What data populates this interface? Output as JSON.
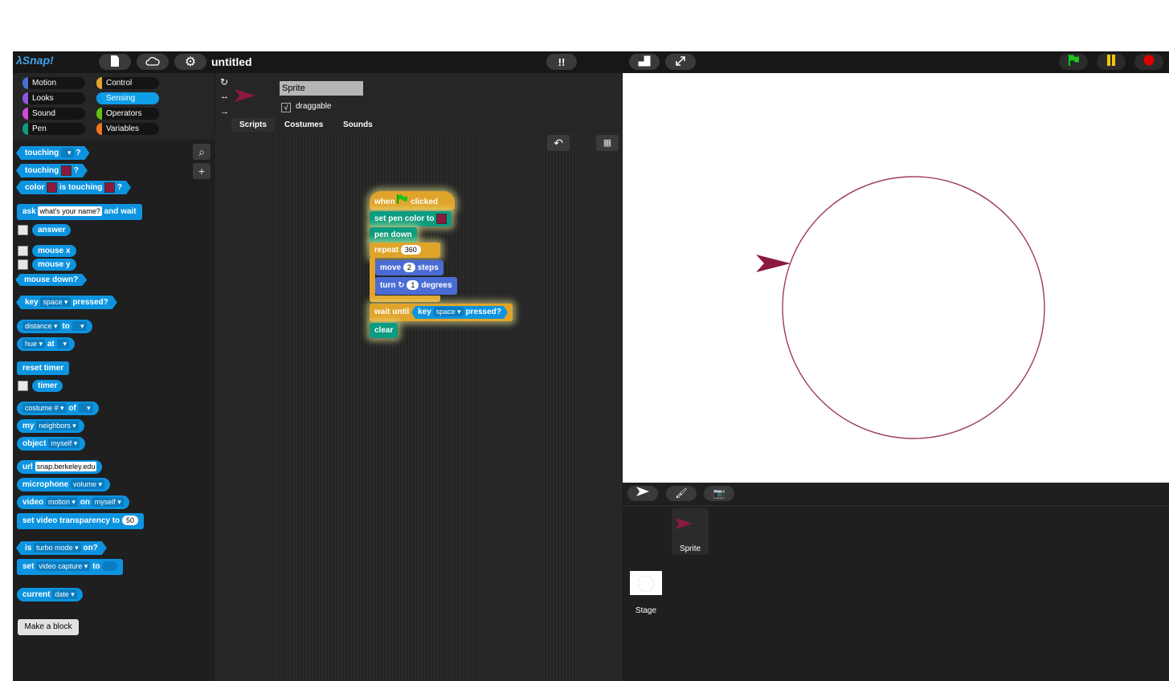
{
  "app": {
    "title": "untitled",
    "logo": "λSnap!"
  },
  "categories": [
    "Motion",
    "Control",
    "Looks",
    "Sensing",
    "Sound",
    "Operators",
    "Pen",
    "Variables"
  ],
  "palette": {
    "touching": "touching",
    "q": "?",
    "color": "color",
    "is_touching": "is touching",
    "ask": "ask",
    "ask_default": "what's your name?",
    "and_wait": "and wait",
    "answer": "answer",
    "mouse_x": "mouse x",
    "mouse_y": "mouse y",
    "mouse_down": "mouse down?",
    "key": "key",
    "space": "space",
    "pressed": "pressed?",
    "distance": "distance",
    "to": "to",
    "hue": "hue",
    "at": "at",
    "reset_timer": "reset timer",
    "timer": "timer",
    "costume": "costume #",
    "of": "of",
    "my": "my",
    "neighbors": "neighbors",
    "object": "object",
    "myself": "myself",
    "url": "url",
    "url_default": "snap.berkeley.edu",
    "microphone": "microphone",
    "volume": "volume",
    "video": "video",
    "motion": "motion",
    "on": "on",
    "set_video_transparency": "set video transparency to",
    "transparency_value": "50",
    "is": "is",
    "turbo_mode": "turbo mode",
    "on_q": "on?",
    "set": "set",
    "video_capture": "video capture",
    "current": "current",
    "date": "date",
    "make_block": "Make a block"
  },
  "sprite": {
    "name": "Sprite",
    "draggable_label": "draggable",
    "draggable_check": "√",
    "tabs": [
      "Scripts",
      "Costumes",
      "Sounds"
    ]
  },
  "script": {
    "when": "when",
    "clicked": "clicked",
    "set_pen_color": "set pen color to",
    "pen_down": "pen down",
    "repeat": "repeat",
    "repeat_count": "360",
    "move": "move",
    "move_steps": "2",
    "steps": "steps",
    "turn": "turn",
    "turn_deg": "1",
    "degrees": "degrees",
    "wait_until": "wait until",
    "key": "key",
    "space": "space",
    "pressed": "pressed?",
    "clear": "clear"
  },
  "corral": {
    "sprite_label": "Sprite",
    "stage_label": "Stage"
  },
  "colors": {
    "pen": "#8b1a3c",
    "sensing": "#0d94e0",
    "control": "#e1a42a",
    "penBlock": "#0b9c81",
    "motion": "#4a6cd4"
  },
  "icons": [
    "file-icon",
    "cloud-icon",
    "gear-icon",
    "footprints-icon",
    "stage-size-icon",
    "fullscreen-icon",
    "green-flag-icon",
    "pause-icon",
    "stop-icon",
    "rotate-icon",
    "search-icon",
    "plus-icon",
    "undo-icon",
    "keyboard-icon",
    "turtle-icon",
    "paintbrush-icon",
    "camera-icon"
  ]
}
